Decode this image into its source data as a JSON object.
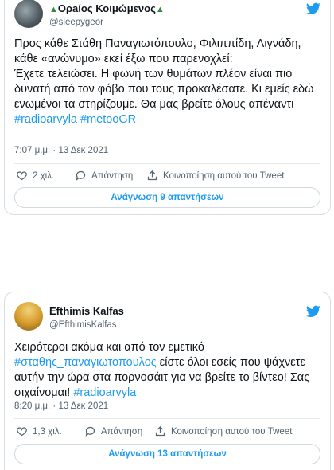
{
  "tweets": [
    {
      "name": "Ορaίος Κοιμώμενος",
      "handle": "@sleepygeor",
      "paragraph1": "Προς κάθε Στάθη Παναγιωτόπουλο, Φιλιππίδη, Λιγνάδη, κάθε «ανώνυμο» εκεί έξω που παρενοχλεί:",
      "paragraph2": "Έχετε τελειώσει. Η φωνή των θυμάτων πλέον είναι πιο δυνατή από τον φόβο που τους προκαλέσατε. Κι εμείς εδώ ενωμένοι τα στηρίζουμε. Θα μας βρείτε όλους απέναντι",
      "hashtags": "#radioarvyla #metooGR",
      "time": "7:07 μ.μ. · 13 Δεκ 2021",
      "likes": "2 χιλ.",
      "reply_label": "Απάντηση",
      "share_label": "Κοινοποίηση αυτού του Tweet",
      "read_replies": "Ανάγνωση 9 απαντήσεων"
    },
    {
      "name": "Efthimis Kalfas",
      "handle": "@EfthimisKalfas",
      "text_before": "Χειρότεροι ακόμα και από τον εμετικό ",
      "inline_tag": "#σταθης_παναγιωτοπουλος",
      "text_after": " είστε όλοι εσείς που ψάχνετε αυτήν την ώρα στα πορνοσάιτ για να βρείτε το βίντεο! Σας σιχαίνομαι! ",
      "end_tag": "#radioarvyla",
      "time": "8:20 μ.μ. · 13 Δεκ 2021",
      "likes": "1,3 χιλ.",
      "reply_label": "Απάντηση",
      "share_label": "Κοινοποίηση αυτού του Tweet",
      "read_replies": "Ανάγνωση 13 απαντήσεων"
    }
  ],
  "colors": {
    "accent": "#1d9bf0",
    "text": "#0f1419",
    "muted": "#536471",
    "border": "#d7dde2",
    "like_icon": "heart-icon",
    "reply_icon": "reply-icon",
    "share_icon": "share-icon",
    "brand_icon": "twitter-bird-icon"
  }
}
